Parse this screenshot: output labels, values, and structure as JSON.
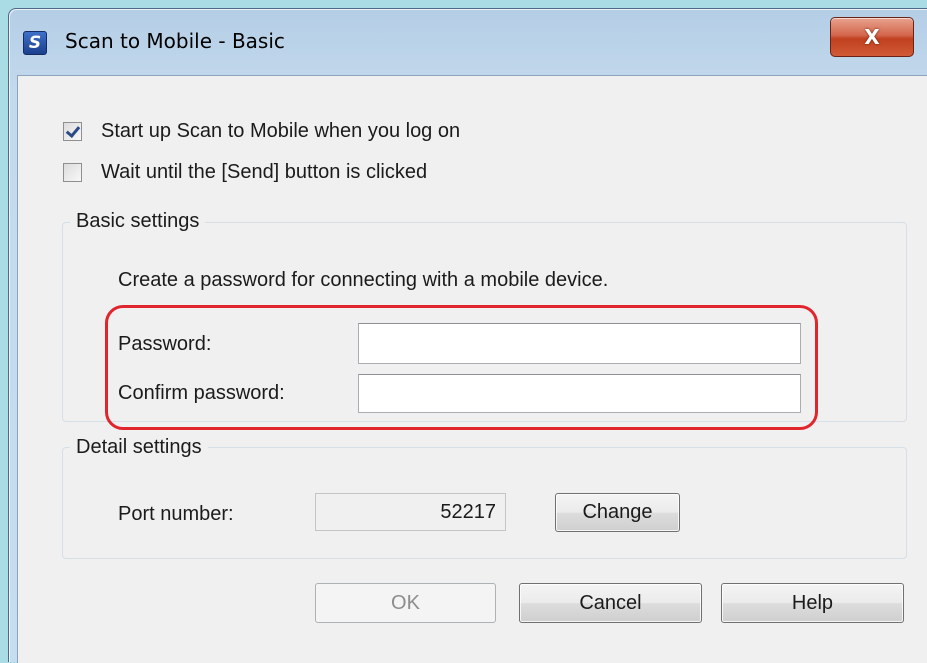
{
  "window": {
    "title": "Scan to Mobile - Basic",
    "close_label": "X"
  },
  "options": {
    "startup": {
      "label": "Start up Scan to Mobile when you log on",
      "checked": true
    },
    "wait_send": {
      "label": "Wait until the [Send] button is clicked",
      "checked": false
    }
  },
  "basic_settings": {
    "legend": "Basic settings",
    "instruction": "Create a password for connecting with a mobile device.",
    "password_label": "Password:",
    "password_value": "",
    "confirm_label": "Confirm password:",
    "confirm_value": ""
  },
  "detail_settings": {
    "legend": "Detail settings",
    "port_label": "Port number:",
    "port_value": "52217",
    "change_label": "Change"
  },
  "buttons": {
    "ok": "OK",
    "cancel": "Cancel",
    "help": "Help"
  },
  "colors": {
    "highlight": "#e0262c",
    "title_bar": "#c3d9ec",
    "close_button": "#c0401f"
  }
}
